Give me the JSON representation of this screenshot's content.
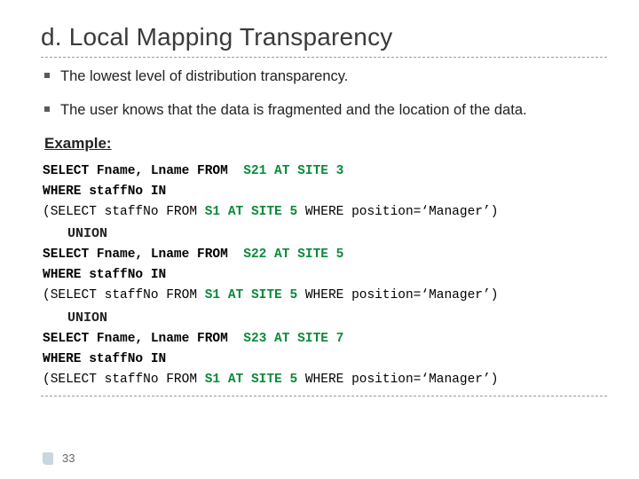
{
  "title": "d. Local Mapping Transparency",
  "bullets": [
    "The lowest level of distribution transparency.",
    "The user knows that the data is fragmented and the location of the data."
  ],
  "example_label": "Example:",
  "blocks": [
    {
      "select_prefix": "SELECT Fname, Lname FROM  ",
      "frag": "S21 AT SITE 3",
      "where_line": "WHERE staffNo IN",
      "sub_prefix": "(SELECT staffNo FROM ",
      "sub_frag": "S1 AT SITE 5",
      "sub_suffix": " WHERE position=‘Manager’)"
    },
    {
      "select_prefix": "SELECT Fname, Lname FROM  ",
      "frag": "S22 AT SITE 5",
      "where_line": "WHERE staffNo IN",
      "sub_prefix": "(SELECT staffNo FROM ",
      "sub_frag": "S1 AT SITE 5",
      "sub_suffix": " WHERE position=‘Manager’)"
    },
    {
      "select_prefix": "SELECT Fname, Lname FROM  ",
      "frag": "S23 AT SITE 7",
      "where_line": "WHERE staffNo IN",
      "sub_prefix": "(SELECT staffNo FROM ",
      "sub_frag": "S1 AT SITE 5",
      "sub_suffix": " WHERE position=‘Manager’)"
    }
  ],
  "union_label": "UNION",
  "page_number": "33"
}
